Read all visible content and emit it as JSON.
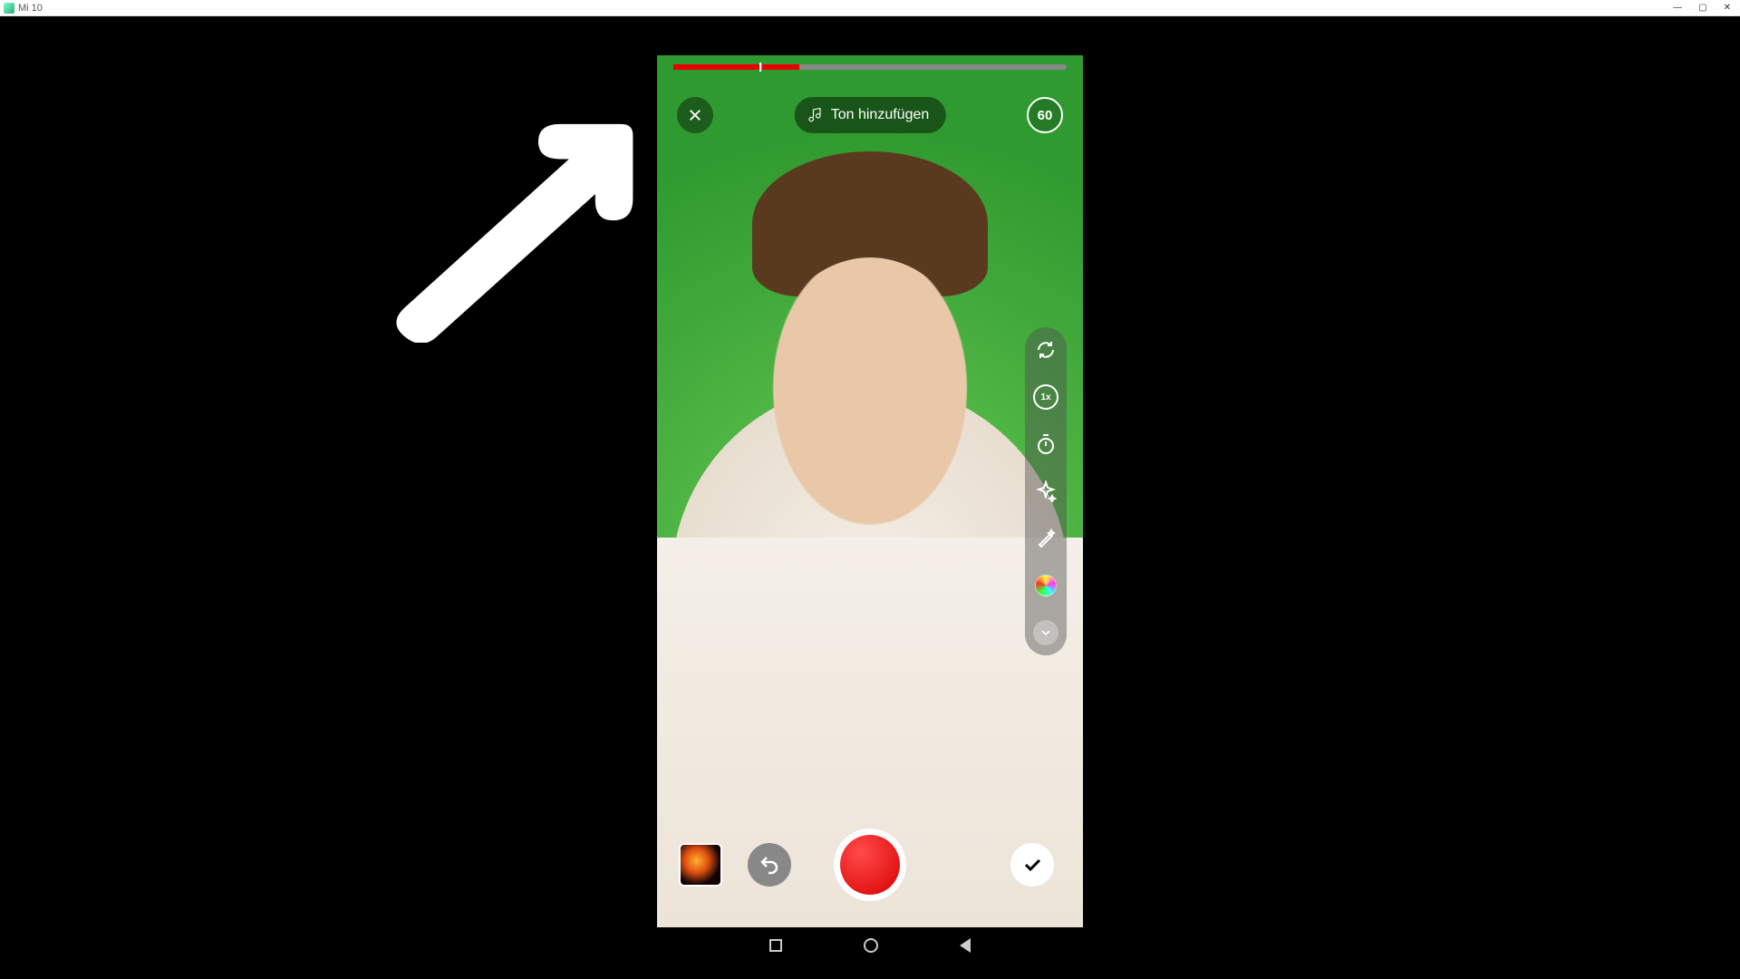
{
  "window": {
    "title": "Mi 10"
  },
  "annotation": {
    "arrow": "pointer-arrow"
  },
  "recorder": {
    "close": "Close",
    "add_sound_label": "Ton hinzufügen",
    "duration_label": "60",
    "progress": {
      "segments": [
        {
          "start_pct": 0,
          "end_pct": 22
        },
        {
          "start_pct": 22.5,
          "end_pct": 32
        }
      ],
      "total_pct": 32
    },
    "side_tools": {
      "flip": "flip-camera",
      "speed": "1x",
      "timer": "timer",
      "effects": "effects",
      "retouch": "retouch",
      "filters": "filters",
      "more": "expand"
    },
    "bottom": {
      "gallery": "gallery",
      "undo": "undo",
      "record": "record",
      "confirm": "confirm"
    }
  },
  "android_nav": {
    "recent": "recent-apps",
    "home": "home",
    "back": "back"
  },
  "colors": {
    "record_red": "#e60000",
    "green_screen": "#39a339"
  }
}
